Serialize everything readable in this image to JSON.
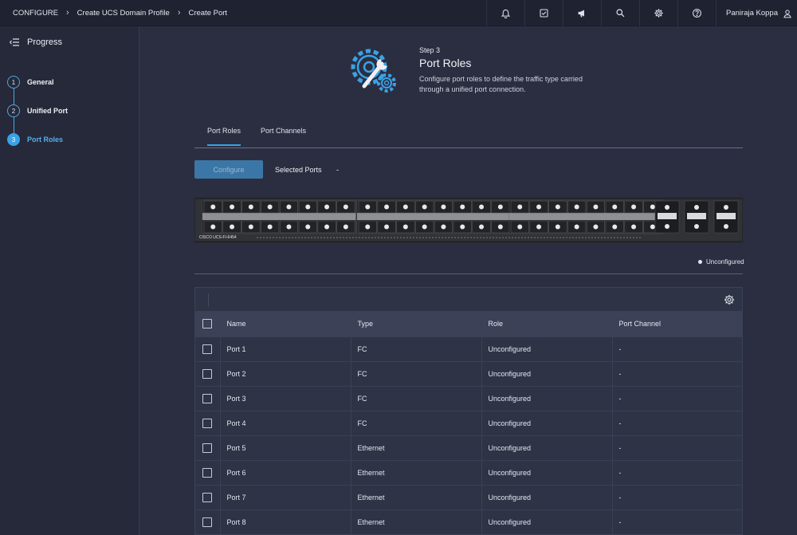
{
  "breadcrumbs": [
    "CONFIGURE",
    "Create UCS Domain Profile",
    "Create Port"
  ],
  "topbar": {
    "icons": [
      "bell-icon",
      "checklist-icon",
      "megaphone-icon",
      "search-icon",
      "gear-icon",
      "help-icon"
    ],
    "user_name": "Paniraja Koppa"
  },
  "sidebar": {
    "title": "Progress",
    "steps": [
      {
        "number": "1",
        "label": "General",
        "state": "done"
      },
      {
        "number": "2",
        "label": "Unified Port",
        "state": "done"
      },
      {
        "number": "3",
        "label": "Port Roles",
        "state": "active"
      }
    ]
  },
  "header": {
    "step": "Step 3",
    "title": "Port Roles",
    "description": "Configure port roles to define the traffic type carried through a unified port connection."
  },
  "tabs": [
    {
      "label": "Port Roles",
      "active": true
    },
    {
      "label": "Port Channels",
      "active": false
    }
  ],
  "actions": {
    "configure_label": "Configure",
    "selected_ports_label": "Selected Ports",
    "selected_ports_value": "-"
  },
  "switch_label": "CISCO UCS-FI-6454",
  "legend": {
    "unconfigured": "Unconfigured"
  },
  "table": {
    "columns": [
      "Name",
      "Type",
      "Role",
      "Port Channel"
    ],
    "rows": [
      {
        "name": "Port 1",
        "type": "FC",
        "role": "Unconfigured",
        "port_channel": "-"
      },
      {
        "name": "Port 2",
        "type": "FC",
        "role": "Unconfigured",
        "port_channel": "-"
      },
      {
        "name": "Port 3",
        "type": "FC",
        "role": "Unconfigured",
        "port_channel": "-"
      },
      {
        "name": "Port 4",
        "type": "FC",
        "role": "Unconfigured",
        "port_channel": "-"
      },
      {
        "name": "Port 5",
        "type": "Ethernet",
        "role": "Unconfigured",
        "port_channel": "-"
      },
      {
        "name": "Port 6",
        "type": "Ethernet",
        "role": "Unconfigured",
        "port_channel": "-"
      },
      {
        "name": "Port 7",
        "type": "Ethernet",
        "role": "Unconfigured",
        "port_channel": "-"
      },
      {
        "name": "Port 8",
        "type": "Ethernet",
        "role": "Unconfigured",
        "port_channel": "-"
      }
    ]
  },
  "colors": {
    "accent": "#3aa2e6",
    "background": "#2b2e40",
    "topbar": "#1f2231"
  }
}
